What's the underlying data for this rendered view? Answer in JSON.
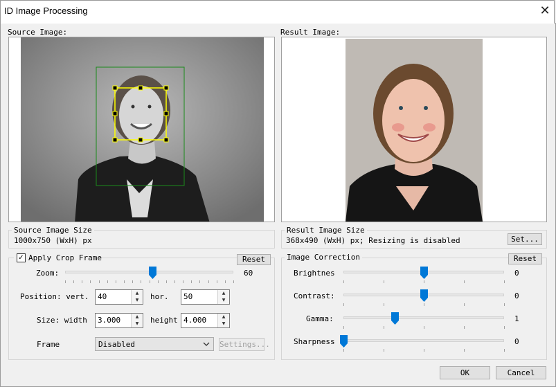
{
  "window": {
    "title": "ID Image Processing",
    "close_glyph": "✕"
  },
  "source": {
    "label": "Source Image:",
    "size_label": "Source Image Size",
    "size_value": "1000x750 (WxH) px"
  },
  "result": {
    "label": "Result Image:",
    "size_label": "Result Image Size",
    "size_value": "368x490 (WxH) px; Resizing is disabled",
    "set_button": "Set..."
  },
  "crop": {
    "checkbox_label": "Apply Crop Frame",
    "checked": true,
    "check_glyph": "✓",
    "reset_label": "Reset",
    "zoom_label": "Zoom:",
    "zoom_value": "60",
    "zoom_fraction": 0.52,
    "position_label": "Position: vert.",
    "vert_value": "40",
    "hor_label": "hor.",
    "hor_value": "50",
    "size_label": "Size: width",
    "width_value": "3.000",
    "height_label": "height",
    "height_value": "4.000",
    "frame_label": "Frame",
    "frame_value": "Disabled",
    "settings_label": "Settings..."
  },
  "correction": {
    "group_label": "Image Correction",
    "reset_label": "Reset",
    "rows": [
      {
        "label": "Brightnes",
        "value": "0",
        "fraction": 0.5
      },
      {
        "label": "Contrast:",
        "value": "0",
        "fraction": 0.5
      },
      {
        "label": "Gamma:",
        "value": "1",
        "fraction": 0.32
      },
      {
        "label": "Sharpness",
        "value": "0",
        "fraction": 0.0
      }
    ]
  },
  "footer": {
    "ok_label": "OK",
    "cancel_label": "Cancel"
  },
  "icons": {
    "spin_up": "▲",
    "spin_down": "▼",
    "combo_arrow": "chevron-down-icon",
    "close": "close-icon"
  },
  "colors": {
    "crop_outer": "#1a8a1a",
    "crop_inner": "#ffff00",
    "slider_thumb": "#0078d7"
  }
}
